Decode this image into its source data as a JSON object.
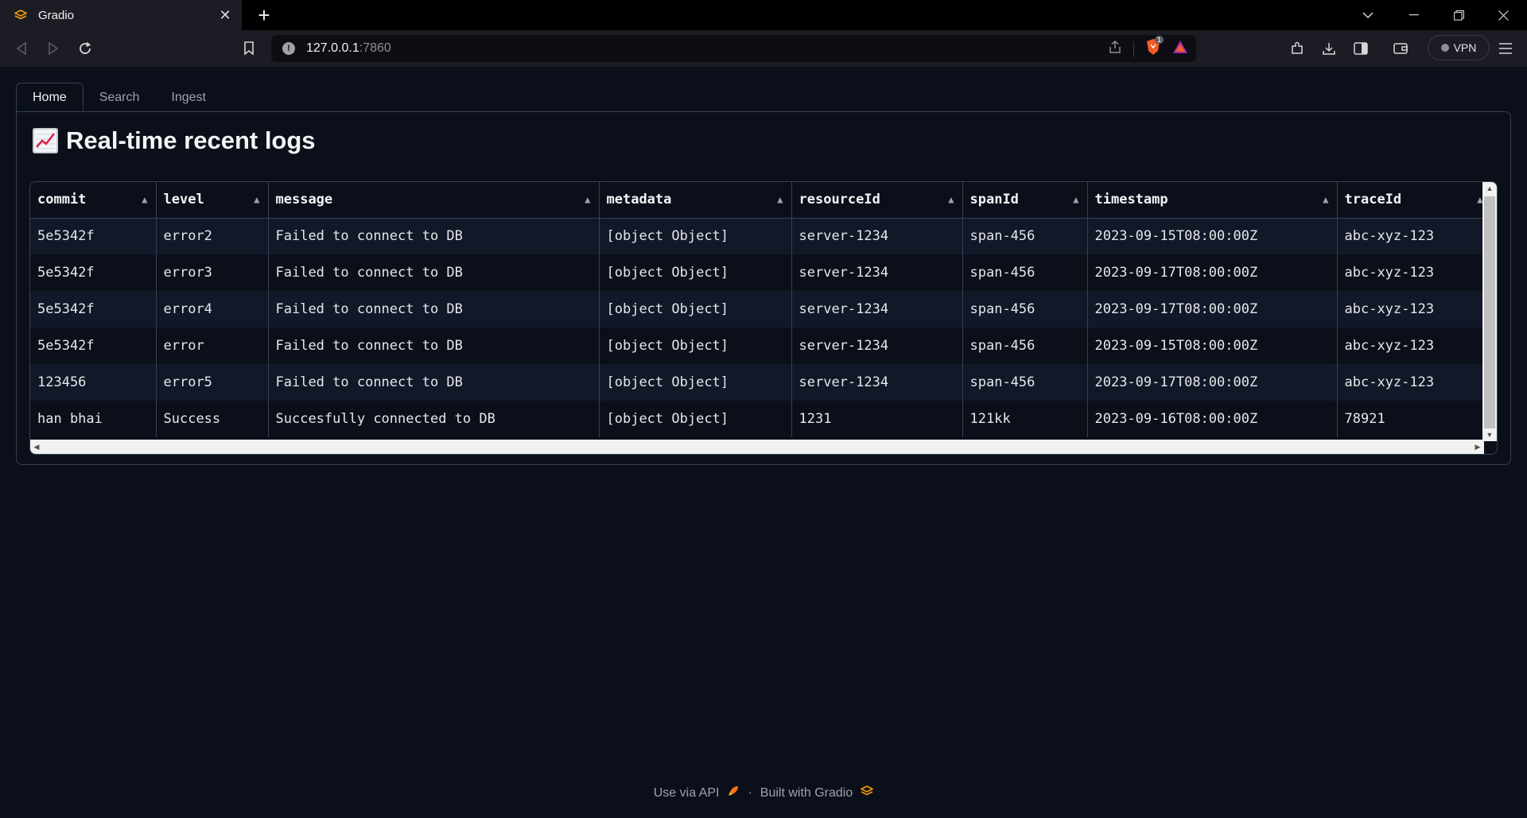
{
  "browser": {
    "tab_title": "Gradio",
    "new_tab": "+",
    "url_host": "127.0.0.1",
    "url_port": ":7860",
    "vpn_label": "VPN",
    "brave_badge": "1"
  },
  "app": {
    "tabs": [
      {
        "label": "Home"
      },
      {
        "label": "Search"
      },
      {
        "label": "Ingest"
      }
    ],
    "heading": "Real-time recent logs",
    "table": {
      "columns": [
        "commit",
        "level",
        "message",
        "metadata",
        "resourceId",
        "spanId",
        "timestamp",
        "traceId"
      ],
      "rows": [
        [
          "5e5342f",
          "error2",
          "Failed to connect to DB",
          "[object Object]",
          "server-1234",
          "span-456",
          "2023-09-15T08:00:00Z",
          "abc-xyz-123"
        ],
        [
          "5e5342f",
          "error3",
          "Failed to connect to DB",
          "[object Object]",
          "server-1234",
          "span-456",
          "2023-09-17T08:00:00Z",
          "abc-xyz-123"
        ],
        [
          "5e5342f",
          "error4",
          "Failed to connect to DB",
          "[object Object]",
          "server-1234",
          "span-456",
          "2023-09-17T08:00:00Z",
          "abc-xyz-123"
        ],
        [
          "5e5342f",
          "error",
          "Failed to connect to DB",
          "[object Object]",
          "server-1234",
          "span-456",
          "2023-09-15T08:00:00Z",
          "abc-xyz-123"
        ],
        [
          "123456",
          "error5",
          "Failed to connect to DB",
          "[object Object]",
          "server-1234",
          "span-456",
          "2023-09-17T08:00:00Z",
          "abc-xyz-123"
        ],
        [
          "han bhai",
          "Success",
          "Succesfully connected to DB",
          "[object Object]",
          "1231",
          "121kk",
          "2023-09-16T08:00:00Z",
          "78921"
        ]
      ]
    },
    "footer": {
      "api_label": "Use via API",
      "separator": "·",
      "built_label": "Built with Gradio"
    }
  },
  "colors": {
    "background": "#0b0f19",
    "row_alt": "#111827",
    "border": "#374151",
    "gradio_orange": "#f97316"
  }
}
